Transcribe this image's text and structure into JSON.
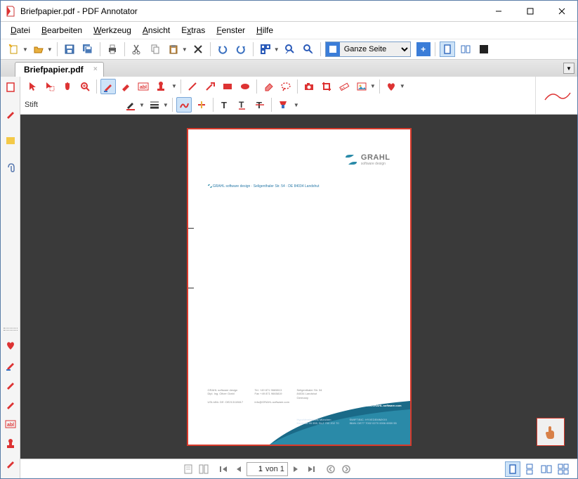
{
  "window": {
    "title": "Briefpapier.pdf - PDF Annotator"
  },
  "menu": {
    "items": [
      "Datei",
      "Bearbeiten",
      "Werkzeug",
      "Ansicht",
      "Extras",
      "Fenster",
      "Hilfe"
    ]
  },
  "zoom": {
    "selected": "Ganze Seite"
  },
  "tab": {
    "label": "Briefpapier.pdf"
  },
  "tool": {
    "pen_label": "Stift"
  },
  "page": {
    "logo_text": "GRAHL",
    "logo_sub": "software design",
    "address_line": "GRAHL software design · Seligenthaler Str. 54 · DE 84034 Landshut",
    "footer_col1_l1": "GRAHL software design",
    "footer_col1_l2": "Dipl. Ing. Oliver Grahl",
    "footer_col1_l3": "USt-IdNr. DE: DE213115617",
    "footer_col2_l1": "Tel. +49 871 9665813",
    "footer_col2_l2": "Fax +49 871 9665819",
    "footer_col2_l3": "info@GRAHL-software.com",
    "footer_col3_l1": "Seligenthaler Str. 54",
    "footer_col3_l2": "84034 Landshut",
    "footer_col3_l3": "Germany",
    "footer_url": "www.GRAHL-software.com",
    "footer_bank1": "HypoVereinsbank München",
    "footer_bank2": "Konto 66 95 955, BLZ 700 202 70",
    "footer_bank3": "SWIFT/BIC: HYVEDEMMXXX",
    "footer_bank4": "IBAN: DE77 7002 0270 0006 6959 55"
  },
  "nav": {
    "current": "1",
    "total_label": "von 1"
  }
}
